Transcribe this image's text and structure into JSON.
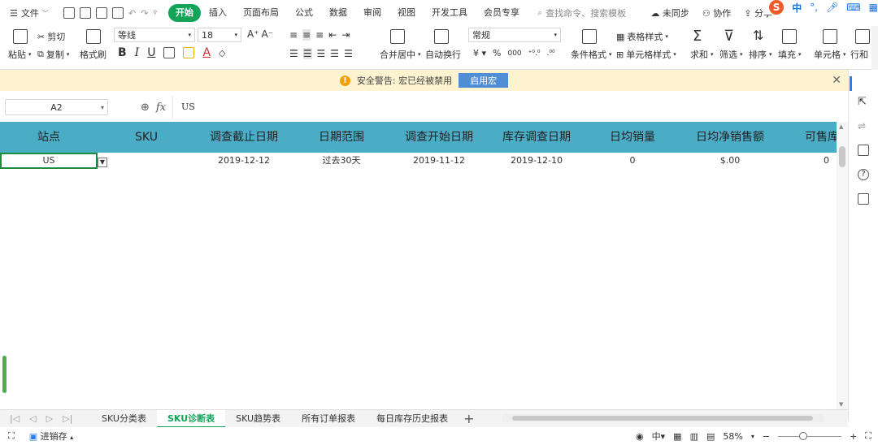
{
  "menubar": {
    "file_label": "文件",
    "tabs": [
      "开始",
      "插入",
      "页面布局",
      "公式",
      "数据",
      "审阅",
      "视图",
      "开发工具",
      "会员专享"
    ],
    "active_tab": "开始",
    "search_placeholder": "查找命令、搜索模板",
    "sync_label": "未同步",
    "collab_label": "协作",
    "share_label": "分享",
    "ime_lang": "中"
  },
  "ribbon": {
    "paste_label": "粘贴",
    "cut_label": "剪切",
    "copy_label": "复制",
    "format_painter_label": "格式刷",
    "font_name": "等线",
    "font_size": "18",
    "merge_center_label": "合并居中",
    "wrap_label": "自动换行",
    "number_format": "常规",
    "cond_format_label": "条件格式",
    "table_style_label": "表格样式",
    "cell_style_label": "单元格样式",
    "sum_label": "求和",
    "filter_label": "筛选",
    "sort_label": "排序",
    "fill_label": "填充",
    "cell_label": "单元格",
    "rowcol_label": "行和"
  },
  "security": {
    "message": "安全警告: 宏已经被禁用",
    "enable_label": "启用宏"
  },
  "formula": {
    "name_box": "A2",
    "fx_label": "fx",
    "content": "US"
  },
  "sheet": {
    "headers": [
      "站点",
      "SKU",
      "调查截止日期",
      "日期范围",
      "调查开始日期",
      "库存调查日期",
      "日均销量",
      "日均净销售额",
      "可售库"
    ],
    "row": [
      "US",
      "",
      "2019-12-12",
      "过去30天",
      "2019-11-12",
      "2019-12-10",
      "0",
      "$.00",
      "0"
    ],
    "header_color": "#4bacc6",
    "active_color": "#1e8e3e"
  },
  "tabs": {
    "sheets": [
      "SKU分类表",
      "SKU诊断表",
      "SKU趋势表",
      "所有订单报表",
      "每日库存历史报表"
    ],
    "active_sheet": "SKU诊断表"
  },
  "status": {
    "mode_label": "进销存",
    "zoom": "58%"
  }
}
